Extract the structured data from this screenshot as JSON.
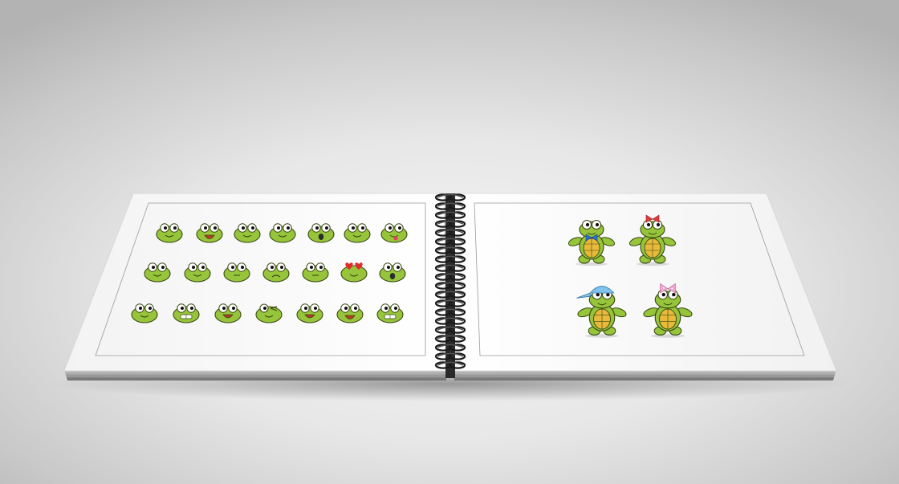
{
  "scene": {
    "subject": "spiral-notebook-mockup",
    "colors": {
      "background_center": "#f5f5f5",
      "background_edge": "#b3b3b3",
      "paper": "#ffffff",
      "turtle_skin": "#96c43a",
      "turtle_outline": "#3a4a12",
      "shell": "#e8b93a",
      "heart": "#e02b2b",
      "blue_bow": "#2f6fd0",
      "red_bow": "#e23a3a",
      "pink_bow": "#f3a6cf",
      "cap": "#7fc3ee",
      "spiral": "#1a1a1a"
    }
  },
  "left_page": {
    "rows": [
      {
        "faces": [
          "dizzy",
          "laughing",
          "smirk",
          "calm",
          "surprised",
          "pleased",
          "tongue-out"
        ]
      },
      {
        "faces": [
          "neutral",
          "smile",
          "plain",
          "frown",
          "flat",
          "heart-eyes",
          "shouting"
        ]
      },
      {
        "faces": [
          "wide-eyed",
          "grin-teeth",
          "happy",
          "winking",
          "happy",
          "excited",
          "buck-teeth"
        ]
      }
    ]
  },
  "right_page": {
    "characters": [
      {
        "name": "boy-turtle-blue-bow-tie",
        "accessory": "bow-tie"
      },
      {
        "name": "girl-turtle-red-bow",
        "accessory": "hair-bow"
      },
      {
        "name": "boy-turtle-blue-cap",
        "accessory": "cap"
      },
      {
        "name": "girl-turtle-pink-bow",
        "accessory": "hair-bow-pink"
      }
    ]
  }
}
